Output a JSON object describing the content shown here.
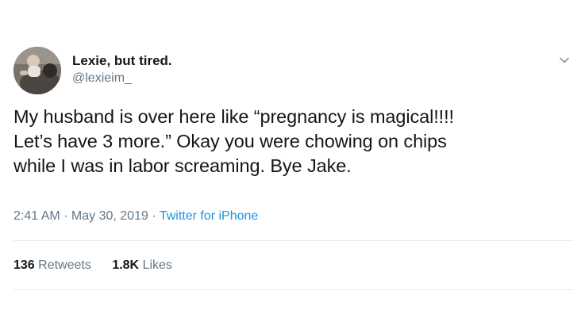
{
  "author": {
    "display_name": "Lexie, but tired.",
    "handle": "@lexieim_"
  },
  "tweet": {
    "lines": [
      "My husband is over here like “pregnancy is magical!!!!",
      "Let’s have 3 more.” Okay you were chowing on chips",
      "while I was in labor screaming. Bye Jake."
    ]
  },
  "meta": {
    "time": "2:41 AM",
    "separator": " · ",
    "date": "May 30, 2019",
    "source": "Twitter for iPhone"
  },
  "stats": {
    "retweets_count": "136",
    "retweets_label": "Retweets",
    "likes_count": "1.8K",
    "likes_label": "Likes"
  },
  "icons": {
    "more_options": "chevron-down-icon"
  },
  "colors": {
    "text_primary": "#14171a",
    "text_secondary": "#657786",
    "link": "#1b95e0",
    "divider": "#e6ecf0"
  }
}
